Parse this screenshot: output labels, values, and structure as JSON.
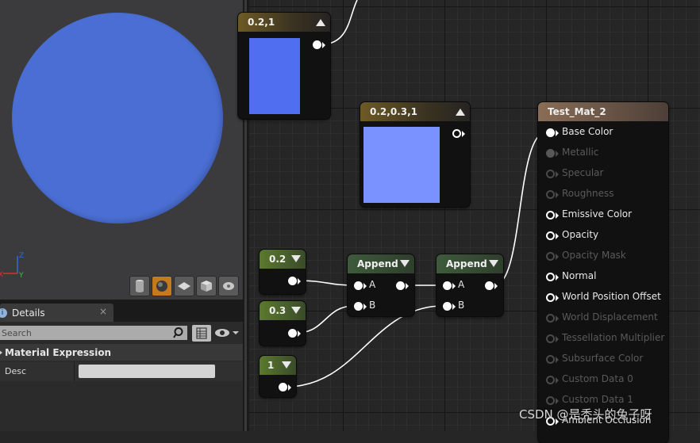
{
  "viewport": {
    "sphere_color": "#4a6ed3",
    "axis": {
      "z": "Z",
      "y": "Y",
      "x": "X"
    },
    "preview_shapes": [
      "cylinder-icon",
      "sphere-icon",
      "plane-icon",
      "cube-icon",
      "custom-mesh-icon"
    ],
    "active_shape": "sphere-icon"
  },
  "details": {
    "tab_label": "Details",
    "close_label": "×",
    "search_placeholder": "Search",
    "section_title": "Material Expression",
    "desc_label": "Desc",
    "desc_value": ""
  },
  "graph": {
    "top_node": {
      "title": "0.2,1",
      "swatch_color": "#4f6ef0"
    },
    "constant3": {
      "title": "0.2,0.3,1",
      "swatch_color": "#7a92ff"
    },
    "constants": [
      {
        "value": "0.2"
      },
      {
        "value": "0.3"
      },
      {
        "value": "1"
      }
    ],
    "append_nodes": [
      {
        "title": "Append",
        "input_a": "A",
        "input_b": "B"
      },
      {
        "title": "Append",
        "input_a": "A",
        "input_b": "B"
      }
    ],
    "result_node": {
      "title": "Test_Mat_2",
      "pins": [
        {
          "label": "Base Color",
          "state": "connected"
        },
        {
          "label": "Metallic",
          "state": "disabled"
        },
        {
          "label": "Specular",
          "state": "disabled"
        },
        {
          "label": "Roughness",
          "state": "disabled"
        },
        {
          "label": "Emissive Color",
          "state": "enabled"
        },
        {
          "label": "Opacity",
          "state": "enabled"
        },
        {
          "label": "Opacity Mask",
          "state": "disabled"
        },
        {
          "label": "Normal",
          "state": "enabled"
        },
        {
          "label": "World Position Offset",
          "state": "enabled"
        },
        {
          "label": "World Displacement",
          "state": "disabled"
        },
        {
          "label": "Tessellation Multiplier",
          "state": "disabled"
        },
        {
          "label": "Subsurface Color",
          "state": "disabled"
        },
        {
          "label": "Custom Data 0",
          "state": "disabled"
        },
        {
          "label": "Custom Data 1",
          "state": "disabled"
        },
        {
          "label": "Ambient Occlusion",
          "state": "enabled"
        }
      ]
    }
  },
  "watermark": "CSDN @是秃头的兔子呀"
}
